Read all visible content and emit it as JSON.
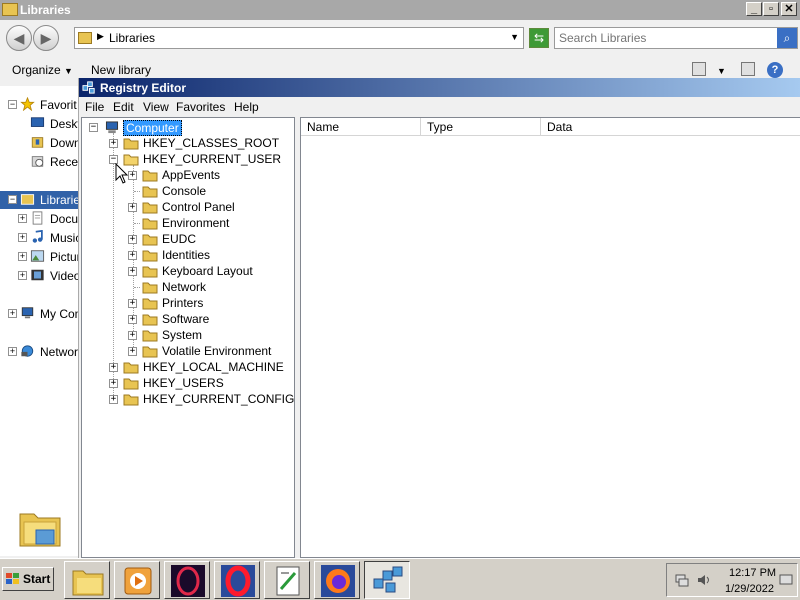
{
  "explorer": {
    "title": "Libraries",
    "address": "Libraries",
    "search_placeholder": "Search Libraries",
    "toolbar": {
      "organize": "Organize",
      "new_library": "New library"
    },
    "nav": [
      {
        "label": "Favorit"
      },
      {
        "label": "Deskt"
      },
      {
        "label": "Down"
      },
      {
        "label": "Rece"
      },
      {
        "label": "Libraries"
      },
      {
        "label": "Docu"
      },
      {
        "label": "Music"
      },
      {
        "label": "Pictur"
      },
      {
        "label": "Video"
      },
      {
        "label": "My Com"
      },
      {
        "label": "Networ"
      }
    ]
  },
  "regedit": {
    "title": "Registry Editor",
    "menu": [
      "File",
      "Edit",
      "View",
      "Favorites",
      "Help"
    ],
    "tree": {
      "root": "Computer",
      "hives": [
        "HKEY_CLASSES_ROOT",
        "HKEY_CURRENT_USER",
        "HKEY_LOCAL_MACHINE",
        "HKEY_USERS",
        "HKEY_CURRENT_CONFIG"
      ],
      "hkcu_children": [
        "AppEvents",
        "Console",
        "Control Panel",
        "Environment",
        "EUDC",
        "Identities",
        "Keyboard Layout",
        "Network",
        "Printers",
        "Software",
        "System",
        "Volatile Environment"
      ]
    },
    "columns": [
      "Name",
      "Type",
      "Data"
    ]
  },
  "taskbar": {
    "start": "Start",
    "time": "12:17 PM",
    "date": "1/29/2022"
  },
  "colors": {
    "title_active_start": "#0a246a",
    "title_active_end": "#a6caf0",
    "selection": "#3399ff",
    "nav_selected": "#3162a8",
    "folder": "#e8c452"
  }
}
